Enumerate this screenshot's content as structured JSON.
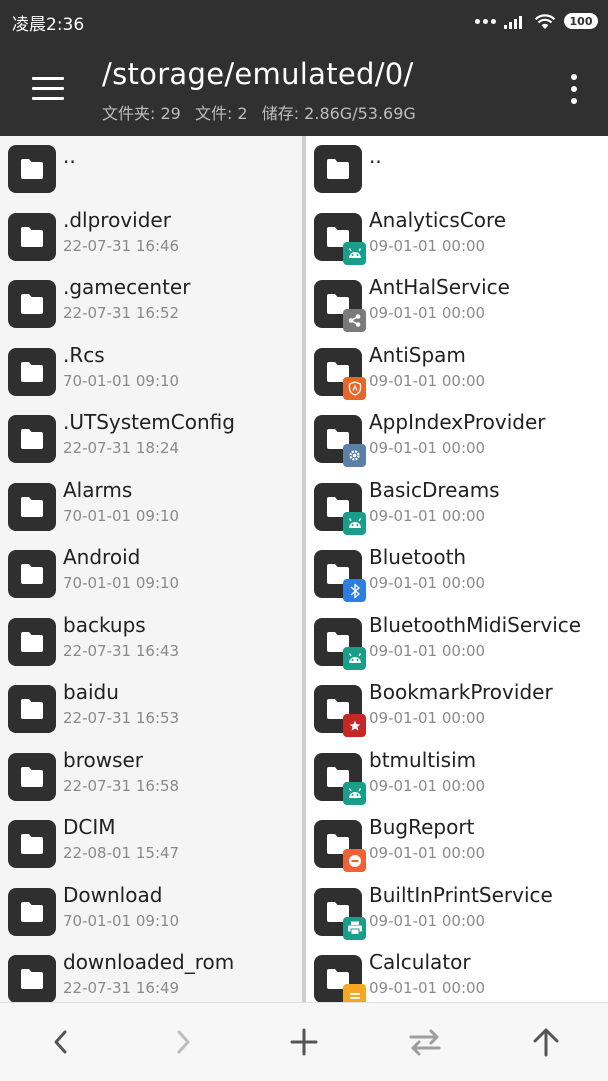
{
  "status": {
    "time": "凌晨2:36",
    "battery": "100"
  },
  "toolbar": {
    "path": "/storage/emulated/0/",
    "folders": "文件夹: 29",
    "files": "文件: 2",
    "storage": "储存: 2.86G/53.69G"
  },
  "left_pane": {
    "parent": "..",
    "items": [
      {
        "name": ".dlprovider",
        "date": "22-07-31 16:46"
      },
      {
        "name": ".gamecenter",
        "date": "22-07-31 16:52"
      },
      {
        "name": ".Rcs",
        "date": "70-01-01 09:10"
      },
      {
        "name": ".UTSystemConfig",
        "date": "22-07-31 18:24"
      },
      {
        "name": "Alarms",
        "date": "70-01-01 09:10"
      },
      {
        "name": "Android",
        "date": "70-01-01 09:10"
      },
      {
        "name": "backups",
        "date": "22-07-31 16:43"
      },
      {
        "name": "baidu",
        "date": "22-07-31 16:53"
      },
      {
        "name": "browser",
        "date": "22-07-31 16:58"
      },
      {
        "name": "DCIM",
        "date": "22-08-01 15:47"
      },
      {
        "name": "Download",
        "date": "70-01-01 09:10"
      },
      {
        "name": "downloaded_rom",
        "date": "22-07-31 16:49"
      }
    ]
  },
  "right_pane": {
    "parent": "..",
    "items": [
      {
        "name": "AnalyticsCore",
        "date": "09-01-01 00:00",
        "badge": "android-icon",
        "badge_color": "#1a9e8a"
      },
      {
        "name": "AntHalService",
        "date": "09-01-01 00:00",
        "badge": "share-icon",
        "badge_color": "#7a7a7a"
      },
      {
        "name": "AntiSpam",
        "date": "09-01-01 00:00",
        "badge": "shield-icon",
        "badge_color": "#e8662b"
      },
      {
        "name": "AppIndexProvider",
        "date": "09-01-01 00:00",
        "badge": "gear-icon",
        "badge_color": "#5b7fa6"
      },
      {
        "name": "BasicDreams",
        "date": "09-01-01 00:00",
        "badge": "android-icon",
        "badge_color": "#1a9e8a"
      },
      {
        "name": "Bluetooth",
        "date": "09-01-01 00:00",
        "badge": "bluetooth-icon",
        "badge_color": "#2d7ee0"
      },
      {
        "name": "BluetoothMidiService",
        "date": "09-01-01 00:00",
        "badge": "android-icon",
        "badge_color": "#1a9e8a"
      },
      {
        "name": "BookmarkProvider",
        "date": "09-01-01 00:00",
        "badge": "bookmark-icon",
        "badge_color": "#c62828"
      },
      {
        "name": "btmultisim",
        "date": "09-01-01 00:00",
        "badge": "android-icon",
        "badge_color": "#1a9e8a"
      },
      {
        "name": "BugReport",
        "date": "09-01-01 00:00",
        "badge": "bug-report-icon",
        "badge_color": "#f06236"
      },
      {
        "name": "BuiltInPrintService",
        "date": "09-01-01 00:00",
        "badge": "printer-icon",
        "badge_color": "#1a9e8a"
      },
      {
        "name": "Calculator",
        "date": "09-01-01 00:00",
        "badge": "calculator-icon",
        "badge_color": "#f5a623"
      }
    ]
  },
  "bottom_bar": {
    "back": "chevron-left-icon",
    "forward": "chevron-right-icon",
    "add": "plus-icon",
    "swap": "swap-arrows-icon",
    "up": "arrow-up-icon"
  }
}
